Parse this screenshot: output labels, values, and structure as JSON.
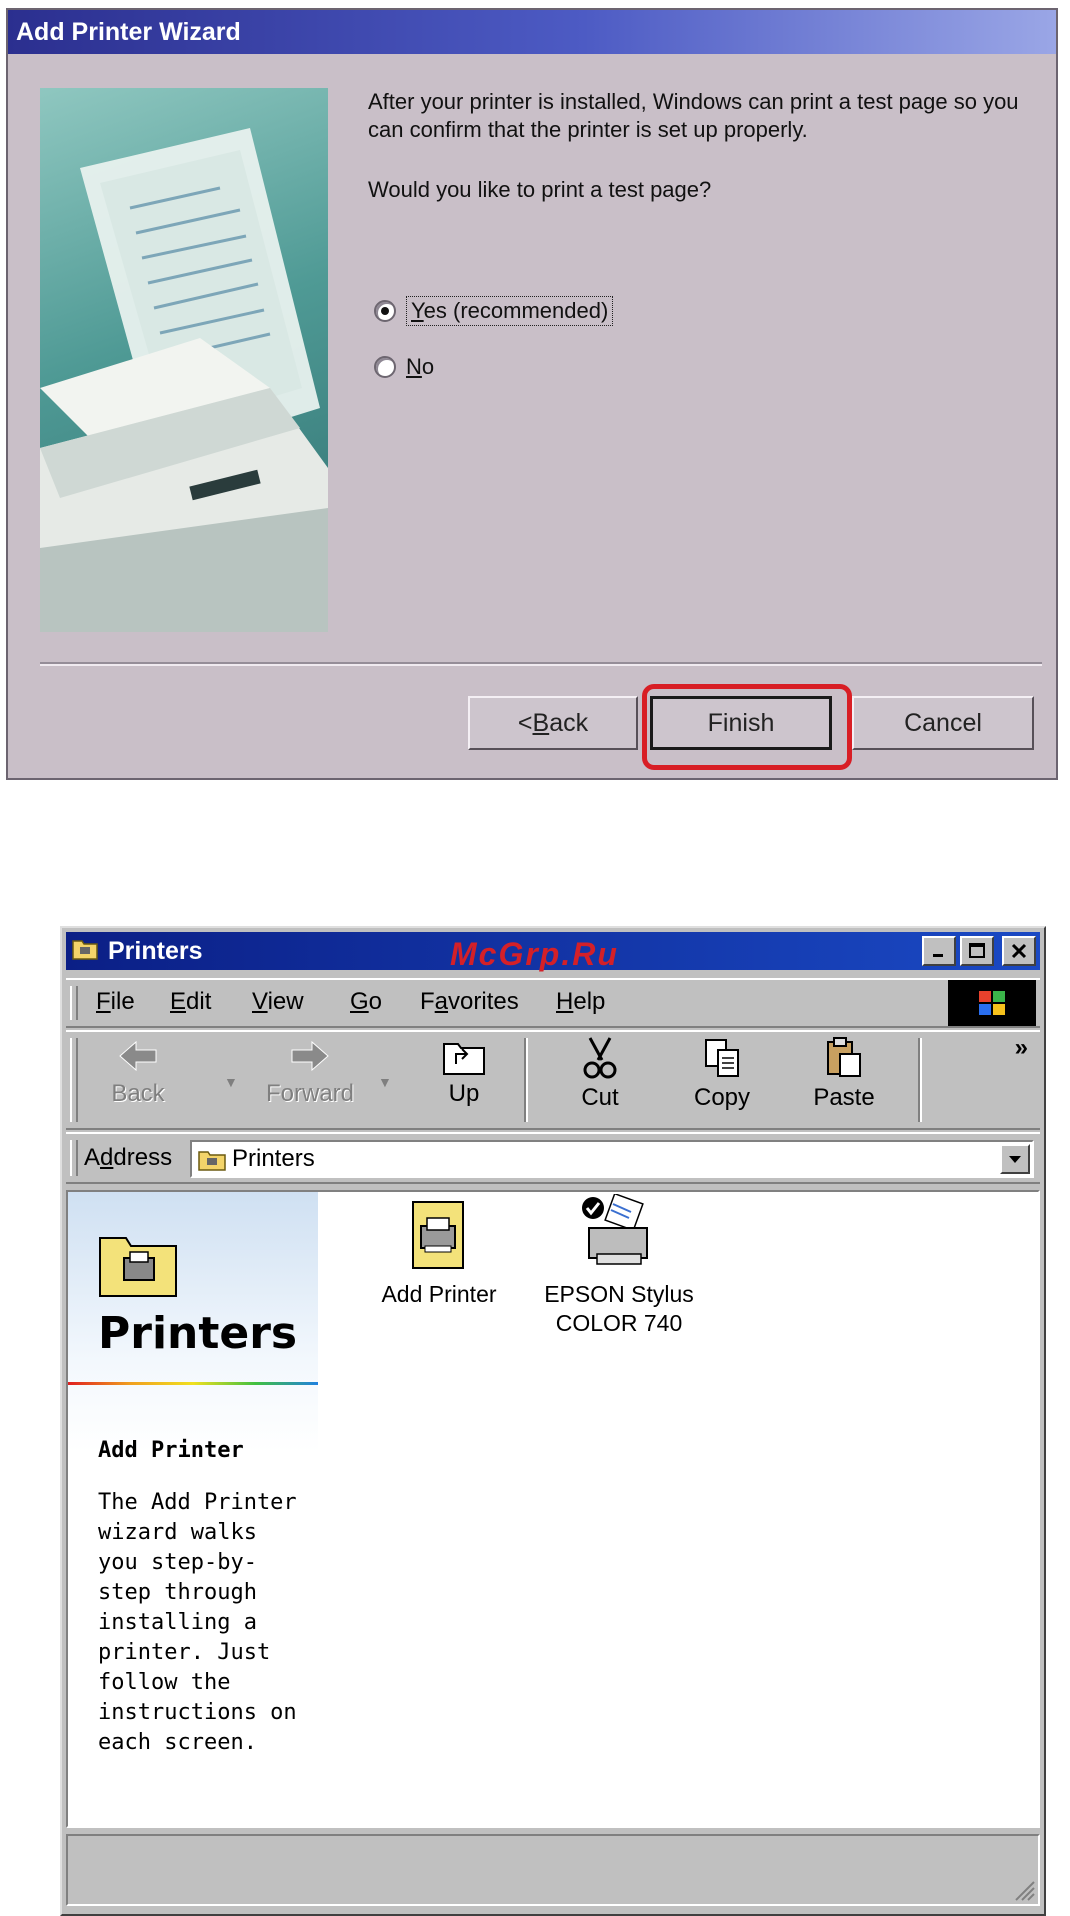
{
  "wizard": {
    "title": "Add Printer Wizard",
    "info_text": "After your printer is installed, Windows can print a test page so you can confirm that the printer is set up properly.",
    "question": "Would you like to print a test page?",
    "options": [
      {
        "label": "Yes (recommended)",
        "mnemonic": "Y",
        "rest": "es (recommended)",
        "selected": true
      },
      {
        "label": "No",
        "mnemonic": "N",
        "rest": "o",
        "selected": false
      }
    ],
    "buttons": {
      "back_prefix": "< ",
      "back_mnemonic": "B",
      "back_rest": "ack",
      "finish": "Finish",
      "cancel": "Cancel"
    },
    "highlight_color": "#d81e25"
  },
  "explorer": {
    "title": "Printers",
    "watermark": "McGrp.Ru",
    "menu": [
      {
        "mn": "F",
        "rest": "ile"
      },
      {
        "mn": "E",
        "rest": "dit"
      },
      {
        "mn": "V",
        "rest": "iew"
      },
      {
        "mn": "G",
        "rest": "o"
      },
      {
        "pre": "F",
        "mn": "a",
        "rest": "vorites"
      },
      {
        "mn": "H",
        "rest": "elp"
      }
    ],
    "toolbar": {
      "back": "Back",
      "forward": "Forward",
      "up": "Up",
      "cut": "Cut",
      "copy": "Copy",
      "paste": "Paste",
      "more": "»"
    },
    "address": {
      "pre": "A",
      "mn": "d",
      "rest": "dress",
      "value": "Printers"
    },
    "sidepanel": {
      "title": "Printers",
      "heading": "Add Printer",
      "description": "The Add Printer wizard walks you step-by-step through installing a printer. Just follow the instructions on each screen."
    },
    "items": [
      {
        "name": "Add Printer",
        "icon": "add-printer-icon"
      },
      {
        "name_line1": "EPSON Stylus",
        "name_line2": "COLOR 740",
        "icon": "printer-icon",
        "default": true
      }
    ],
    "title_bar_color": "#0b1f86"
  }
}
